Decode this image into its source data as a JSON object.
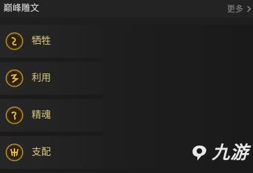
{
  "header": {
    "title": "巅峰雕文",
    "more_label": "更多"
  },
  "items": [
    {
      "label": "牺牲",
      "icon": "sacrifice-glyph-icon"
    },
    {
      "label": "利用",
      "icon": "exploit-glyph-icon"
    },
    {
      "label": "精魂",
      "icon": "spirit-glyph-icon"
    },
    {
      "label": "支配",
      "icon": "dominate-glyph-icon"
    }
  ],
  "watermark": {
    "text": "九游"
  },
  "colors": {
    "background": "#1b1b1b",
    "label_gold": "#d8c87f",
    "icon_gold": "#b9902d"
  }
}
